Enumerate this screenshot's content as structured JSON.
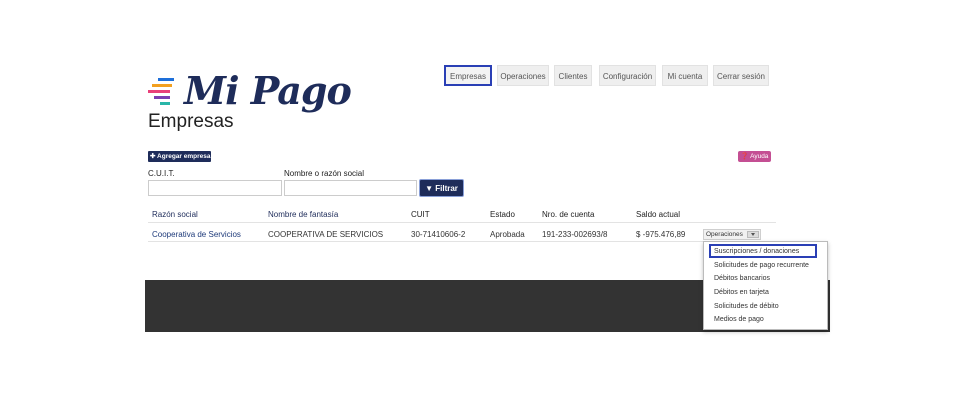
{
  "brand": {
    "name": "Mi Pago",
    "colors": {
      "navy": "#1e2c5a",
      "help": "#c44f93",
      "highlight": "#2a3fb5"
    }
  },
  "nav": [
    "Empresas",
    "Operaciones",
    "Clientes",
    "Configuración",
    "Mi cuenta",
    "Cerrar sesión"
  ],
  "page_title": "Empresas",
  "toolbar": {
    "add_label": "Agregar empresa",
    "add_icon": "plus-icon",
    "help_label": "Ayuda",
    "help_icon": "question-icon"
  },
  "filters": {
    "cuit_label": "C.U.I.T.",
    "cuit_value": "",
    "name_label": "Nombre o razón social",
    "name_value": "",
    "filter_label": "Filtrar",
    "filter_icon": "filter-icon"
  },
  "table": {
    "headers": [
      "Razón social",
      "Nombre de fantasía",
      "CUIT",
      "Estado",
      "Nro. de cuenta",
      "Saldo actual"
    ],
    "rows": [
      {
        "razon": "Cooperativa de Servicios",
        "fantasia": "COOPERATIVA DE SERVICIOS",
        "cuit": "30-71410606-2",
        "estado": "Aprobada",
        "cuenta": "191-233-002693/8",
        "saldo": "$ -975.476,89",
        "action": "Operaciones"
      }
    ]
  },
  "dropdown": {
    "items": [
      "Suscripciones / donaciones",
      "Solicitudes de pago recurrente",
      "Débitos bancarios",
      "Débitos en tarjeta",
      "Solicitudes de débito",
      "Medios de pago"
    ]
  }
}
